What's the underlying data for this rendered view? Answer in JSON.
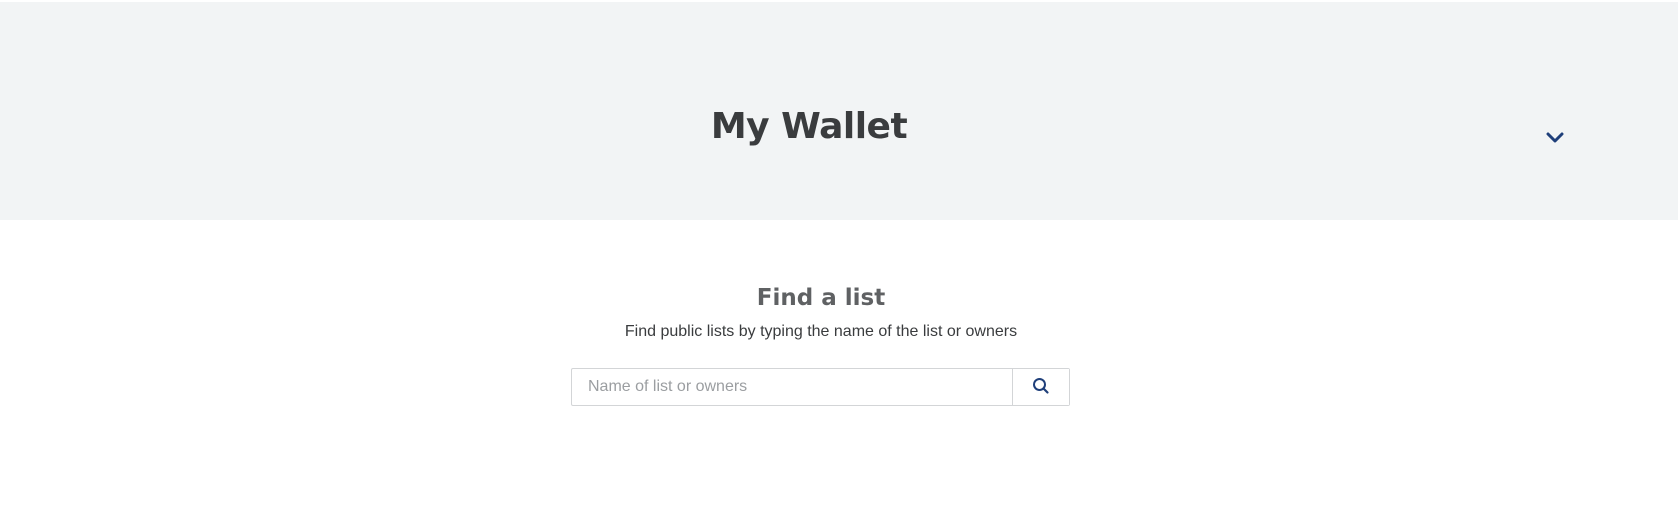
{
  "header": {
    "title": "My Wallet",
    "toggle_icon": "chevron-down-icon"
  },
  "find_list": {
    "title": "Find a list",
    "subtitle": "Find public lists by typing the name of the list or owners",
    "search": {
      "placeholder": "Name of list or owners",
      "value": "",
      "button_icon": "search-icon"
    }
  },
  "colors": {
    "header_background": "#f2f4f5",
    "title_text": "#3a3c3e",
    "accent": "#1f3f7a",
    "input_border": "#d3d5d7",
    "placeholder_text": "#9b9ea1"
  }
}
